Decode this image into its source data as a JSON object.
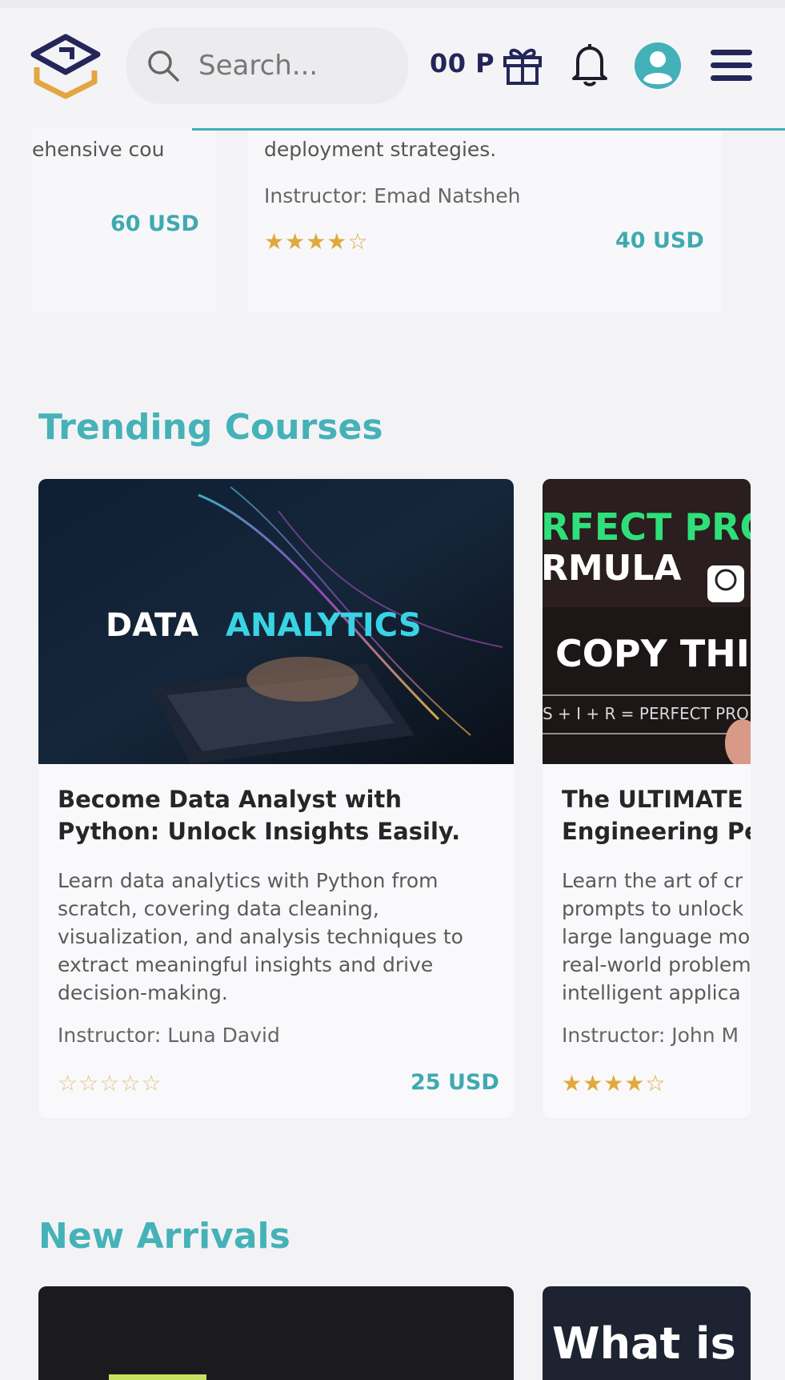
{
  "header": {
    "search_placeholder": "Search...",
    "points": "00 P"
  },
  "top_row": {
    "left_card": {
      "desc_fragment": "ehensive cou",
      "price": "60 USD"
    },
    "right_card": {
      "desc_fragment": "deployment strategies.",
      "instructor": "Instructor: Emad Natsheh",
      "rating_stars": "★★★★☆",
      "rating": 4,
      "price": "40 USD"
    }
  },
  "trending": {
    "title": "Trending Courses",
    "courses": [
      {
        "thumb_text_1": "DATA",
        "thumb_text_2": "ANALYTICS",
        "title": "Become Data Analyst with Python: Unlock Insights Easily.",
        "description": "Learn data analytics with Python from scratch, covering data cleaning, visualization, and analysis techniques to extract meaningful insights and drive decision-making.",
        "instructor": "Instructor: Luna David",
        "rating_stars": "☆☆☆☆☆",
        "rating": 0,
        "price": "25 USD"
      },
      {
        "thumb_line_1": "RFECT PRO",
        "thumb_line_2": "RMULA",
        "thumb_line_3": "COPY THI",
        "thumb_line_4": "S + I + R = PERFECT PRO",
        "title_line_1": "The ULTIMATE",
        "title_line_2": "Engineering Pe",
        "desc_line_1": "Learn the art of cr",
        "desc_line_2": "prompts to unlock",
        "desc_line_3": "large language mo",
        "desc_line_4": "real-world problem",
        "desc_line_5": "intelligent applica",
        "instructor": "Instructor: John M",
        "rating_stars": "★★★★☆",
        "rating": 4
      }
    ]
  },
  "new_arrivals": {
    "title": "New Arrivals",
    "second_thumb_text": "What is"
  },
  "colors": {
    "accent_teal": "#45b2b8",
    "brand_navy": "#242659",
    "star_gold": "#e0a93e"
  }
}
